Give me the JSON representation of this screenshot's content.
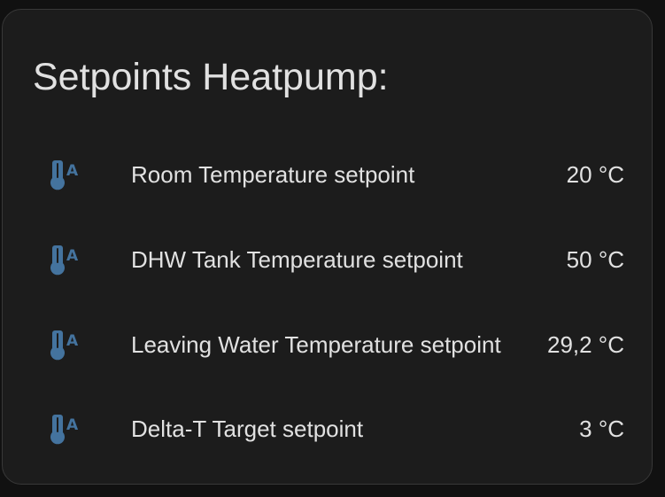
{
  "card": {
    "title": "Setpoints Heatpump:",
    "icon_color": "#44739e",
    "entities": [
      {
        "icon": "thermometer-auto-icon",
        "name": "Room Temperature setpoint",
        "state": "20 °C"
      },
      {
        "icon": "thermometer-auto-icon",
        "name": "DHW Tank Temperature setpoint",
        "state": "50 °C"
      },
      {
        "icon": "thermometer-auto-icon",
        "name": "Leaving Water Temperature setpoint",
        "state": "29,2 °C"
      },
      {
        "icon": "thermometer-auto-icon",
        "name": "Delta-T Target setpoint",
        "state": "3 °C"
      }
    ]
  }
}
